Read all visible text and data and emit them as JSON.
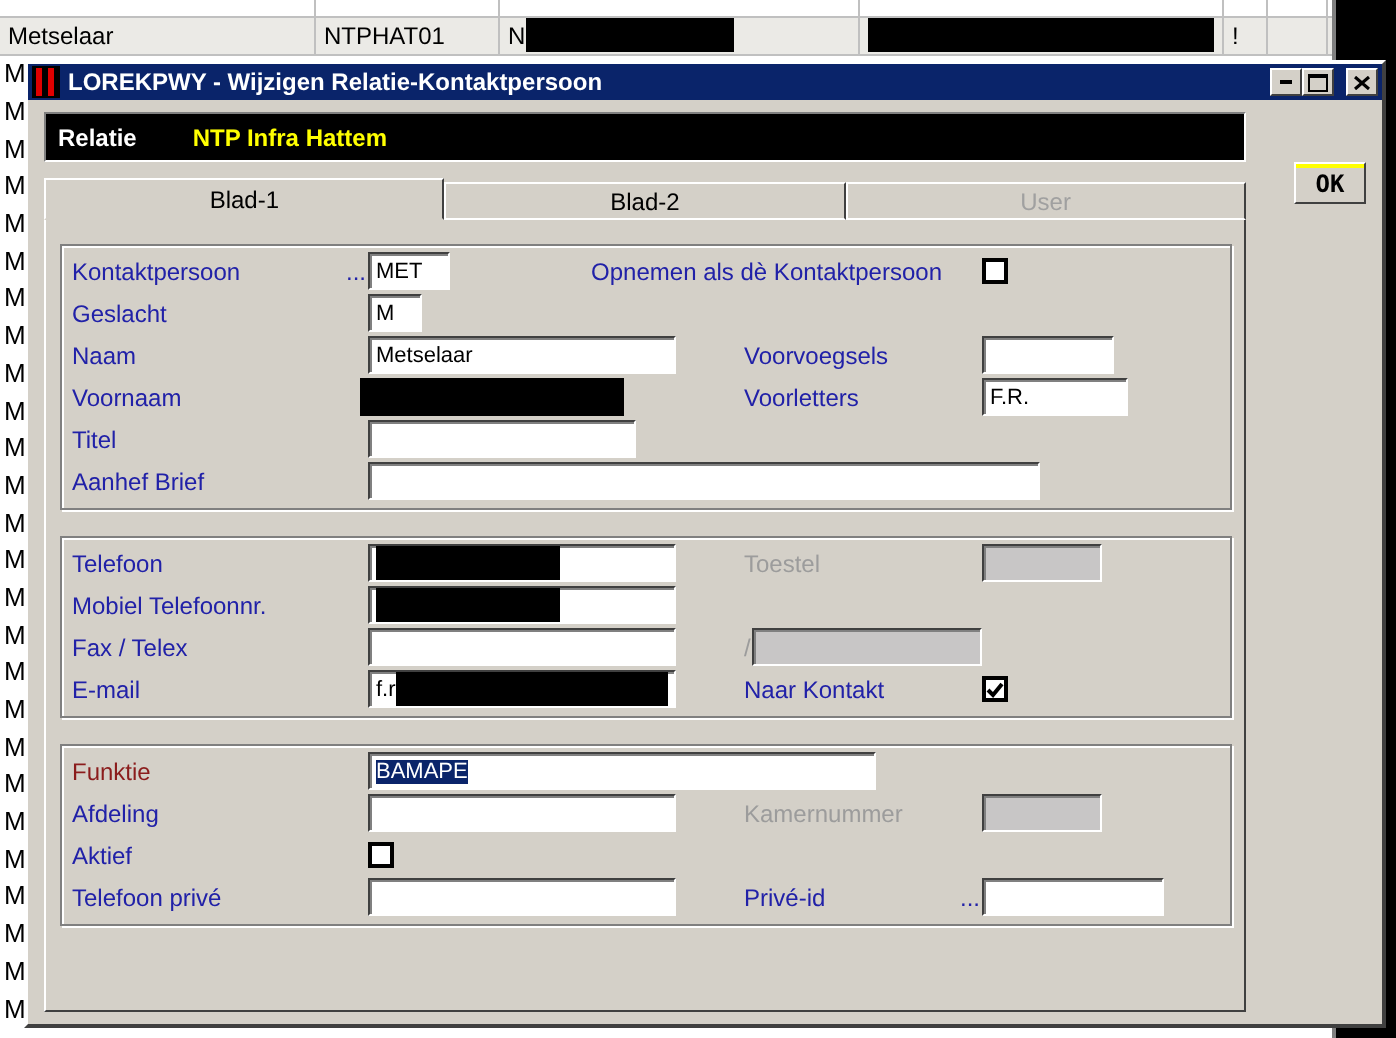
{
  "background_table": {
    "rows": [
      {
        "selected": true,
        "cells": [
          {
            "text": "Metselaar",
            "redacted": false
          },
          {
            "text": "NTPHAT01",
            "redacted": false
          },
          {
            "text": "N",
            "redacted": true
          },
          {
            "redacted": true
          },
          {
            "text": "!",
            "redacted": false
          }
        ]
      }
    ],
    "hidden_rows": [
      {
        "text": "M"
      },
      {
        "text": "M"
      },
      {
        "text": "M"
      },
      {
        "text": "M"
      },
      {
        "text": "M"
      },
      {
        "text": "M"
      },
      {
        "text": "M"
      },
      {
        "text": "M"
      },
      {
        "text": "M"
      },
      {
        "text": "M"
      },
      {
        "text": "M"
      },
      {
        "text": "M"
      },
      {
        "text": "M"
      },
      {
        "text": "M"
      },
      {
        "text": "M"
      },
      {
        "text": "M"
      },
      {
        "text": "M"
      },
      {
        "text": "M"
      },
      {
        "text": "M"
      },
      {
        "text": "M"
      },
      {
        "text": "M"
      },
      {
        "text": "M"
      },
      {
        "text": "M"
      },
      {
        "text": "M"
      },
      {
        "text": "M"
      },
      {
        "text": "M"
      }
    ]
  },
  "dialog": {
    "title": "LOREKPWY - Wijzigen Relatie-Kontaktpersoon",
    "relatie": {
      "label": "Relatie",
      "value": "NTP Infra Hattem"
    },
    "ok_button": "OK",
    "tabs": [
      {
        "label": "Blad-1",
        "selected": true,
        "disabled": false
      },
      {
        "label": "Blad-2",
        "selected": false,
        "disabled": false
      },
      {
        "label": "User",
        "selected": false,
        "disabled": true
      }
    ],
    "groups": [
      {
        "rows": [
          {
            "left": {
              "kind": "field",
              "label": "Kontaktpersoon",
              "prefix": "...",
              "value": "MET",
              "disabled": false,
              "focused": false,
              "redacted": false
            },
            "right": {
              "kind": "checkbox",
              "label": "Opnemen als dè Kontaktpersoon",
              "checked": false
            }
          },
          {
            "left": {
              "kind": "field",
              "label": "Geslacht",
              "value": "M",
              "disabled": false,
              "focused": false,
              "redacted": false
            }
          },
          {
            "left": {
              "kind": "field",
              "label": "Naam",
              "value": "Metselaar",
              "disabled": false,
              "focused": false,
              "redacted": false
            },
            "right": {
              "kind": "field",
              "label": "Voorvoegsels",
              "disabled": false,
              "focused": false,
              "redacted": false
            }
          },
          {
            "left": {
              "kind": "field",
              "label": "Voornaam",
              "disabled": false,
              "focused": false,
              "redacted": true
            },
            "right": {
              "kind": "field",
              "label": "Voorletters",
              "value": "F.R.",
              "disabled": false,
              "focused": false,
              "redacted": false
            }
          },
          {
            "left": {
              "kind": "field",
              "label": "Titel",
              "disabled": false,
              "focused": false,
              "redacted": false
            }
          },
          {
            "left": {
              "kind": "field",
              "label": "Aanhef Brief",
              "disabled": false,
              "focused": false,
              "redacted": false
            }
          }
        ]
      },
      {
        "rows": [
          {
            "left": {
              "kind": "field",
              "label": "Telefoon",
              "disabled": false,
              "focused": false,
              "redacted": true
            },
            "right": {
              "kind": "field",
              "label": "Toestel",
              "disabled": true,
              "focused": false,
              "redacted": false
            }
          },
          {
            "left": {
              "kind": "field",
              "label": "Mobiel Telefoonnr.",
              "disabled": false,
              "focused": false,
              "redacted": true
            }
          },
          {
            "left": {
              "kind": "field",
              "label": "Fax / Telex",
              "disabled": false,
              "focused": false,
              "redacted": false
            },
            "right": {
              "kind": "separator_field",
              "label": "/",
              "disabled": true,
              "focused": false,
              "redacted": false
            }
          },
          {
            "left": {
              "kind": "field",
              "label": "E-mail",
              "value": "f.r",
              "disabled": false,
              "focused": false,
              "redacted": true
            },
            "right": {
              "kind": "checkbox",
              "label": "Naar Kontakt",
              "checked": true
            }
          }
        ]
      },
      {
        "rows": [
          {
            "left": {
              "kind": "field",
              "label": "Funktie",
              "value": "BAMAPE",
              "disabled": false,
              "focused": true,
              "redacted": false
            }
          },
          {
            "left": {
              "kind": "field",
              "label": "Afdeling",
              "disabled": false,
              "focused": false,
              "redacted": false
            },
            "right": {
              "kind": "field",
              "label": "Kamernummer",
              "disabled": true,
              "focused": false,
              "redacted": false
            }
          },
          {
            "left": {
              "kind": "checkbox",
              "label": "Aktief",
              "checked": false
            }
          },
          {
            "left": {
              "kind": "field",
              "label": "Telefoon privé",
              "disabled": false,
              "focused": false,
              "redacted": false
            },
            "right": {
              "kind": "field",
              "label": "Privé-id",
              "prefix": "...",
              "disabled": false,
              "focused": false,
              "redacted": false
            }
          }
        ]
      }
    ]
  }
}
